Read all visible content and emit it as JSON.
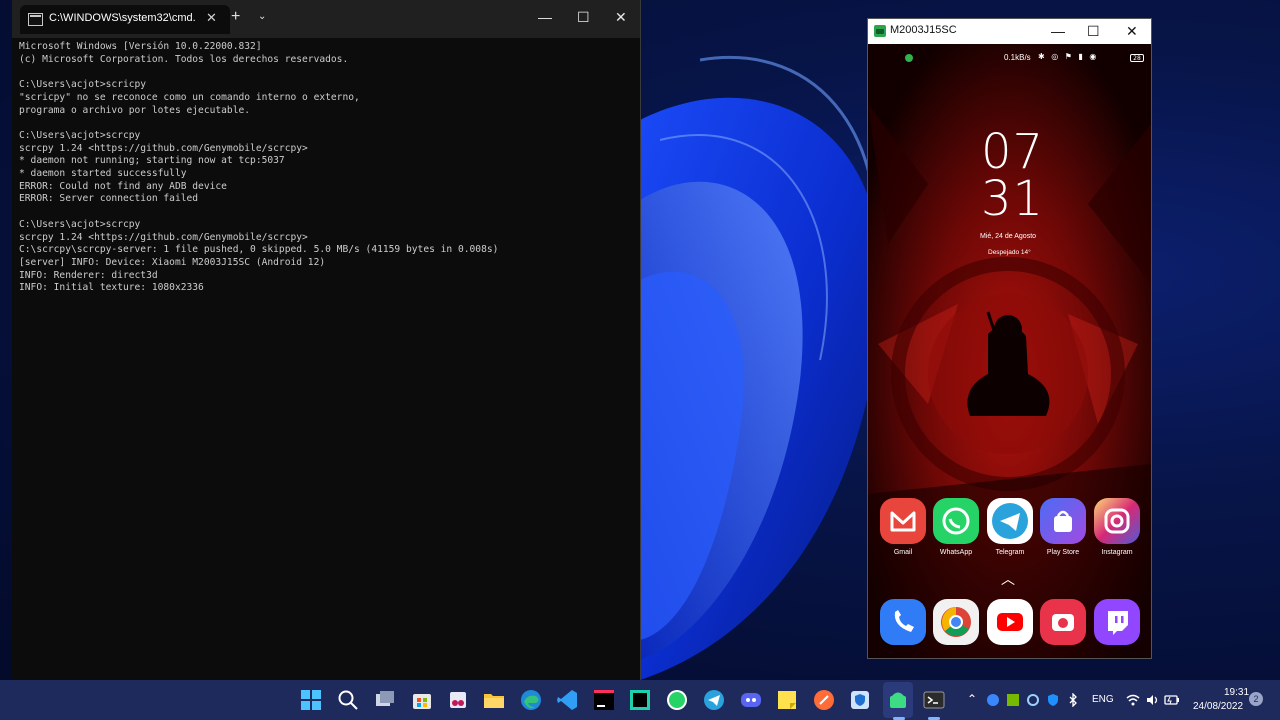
{
  "terminal": {
    "tab_title": "C:\\WINDOWS\\system32\\cmd.",
    "lines": [
      "Microsoft Windows [Versión 10.0.22000.832]",
      "(c) Microsoft Corporation. Todos los derechos reservados.",
      "",
      "C:\\Users\\acjot>scricpy",
      "\"scricpy\" no se reconoce como un comando interno o externo,",
      "programa o archivo por lotes ejecutable.",
      "",
      "C:\\Users\\acjot>scrcpy",
      "scrcpy 1.24 <https://github.com/Genymobile/scrcpy>",
      "* daemon not running; starting now at tcp:5037",
      "* daemon started successfully",
      "ERROR: Could not find any ADB device",
      "ERROR: Server connection failed",
      "",
      "C:\\Users\\acjot>scrcpy",
      "scrcpy 1.24 <https://github.com/Genymobile/scrcpy>",
      "C:\\scrcpy\\scrcpy-server: 1 file pushed, 0 skipped. 5.0 MB/s (41159 bytes in 0.008s)",
      "[server] INFO: Device: Xiaomi M2003J15SC (Android 12)",
      "INFO: Renderer: direct3d",
      "INFO: Initial texture: 1080x2336"
    ]
  },
  "phone_window": {
    "title": "M2003J15SC",
    "status_speed": "0.1kB/s",
    "battery": "28",
    "clock_hours": "07",
    "clock_minutes": "31",
    "date": "Mié, 24 de Agosto",
    "weather": "Despejado  14°",
    "dock_apps": [
      {
        "label": "Gmail",
        "color": "#e8453c",
        "icon": "gmail-icon"
      },
      {
        "label": "WhatsApp",
        "color": "#25d366",
        "icon": "whatsapp-icon"
      },
      {
        "label": "Telegram",
        "color": "#ffffff",
        "icon": "telegram-icon"
      },
      {
        "label": "Play Store",
        "color": "#7b5cf0",
        "icon": "play-store-icon"
      },
      {
        "label": "Instagram",
        "color": "#d62976",
        "icon": "instagram-icon"
      }
    ],
    "bottom_apps": [
      "phone-icon",
      "chrome-icon",
      "youtube-icon",
      "camera-icon",
      "twitch-icon"
    ]
  },
  "taskbar": {
    "language": "ENG",
    "time": "19:31",
    "date": "24/08/2022",
    "notifications": "2"
  }
}
